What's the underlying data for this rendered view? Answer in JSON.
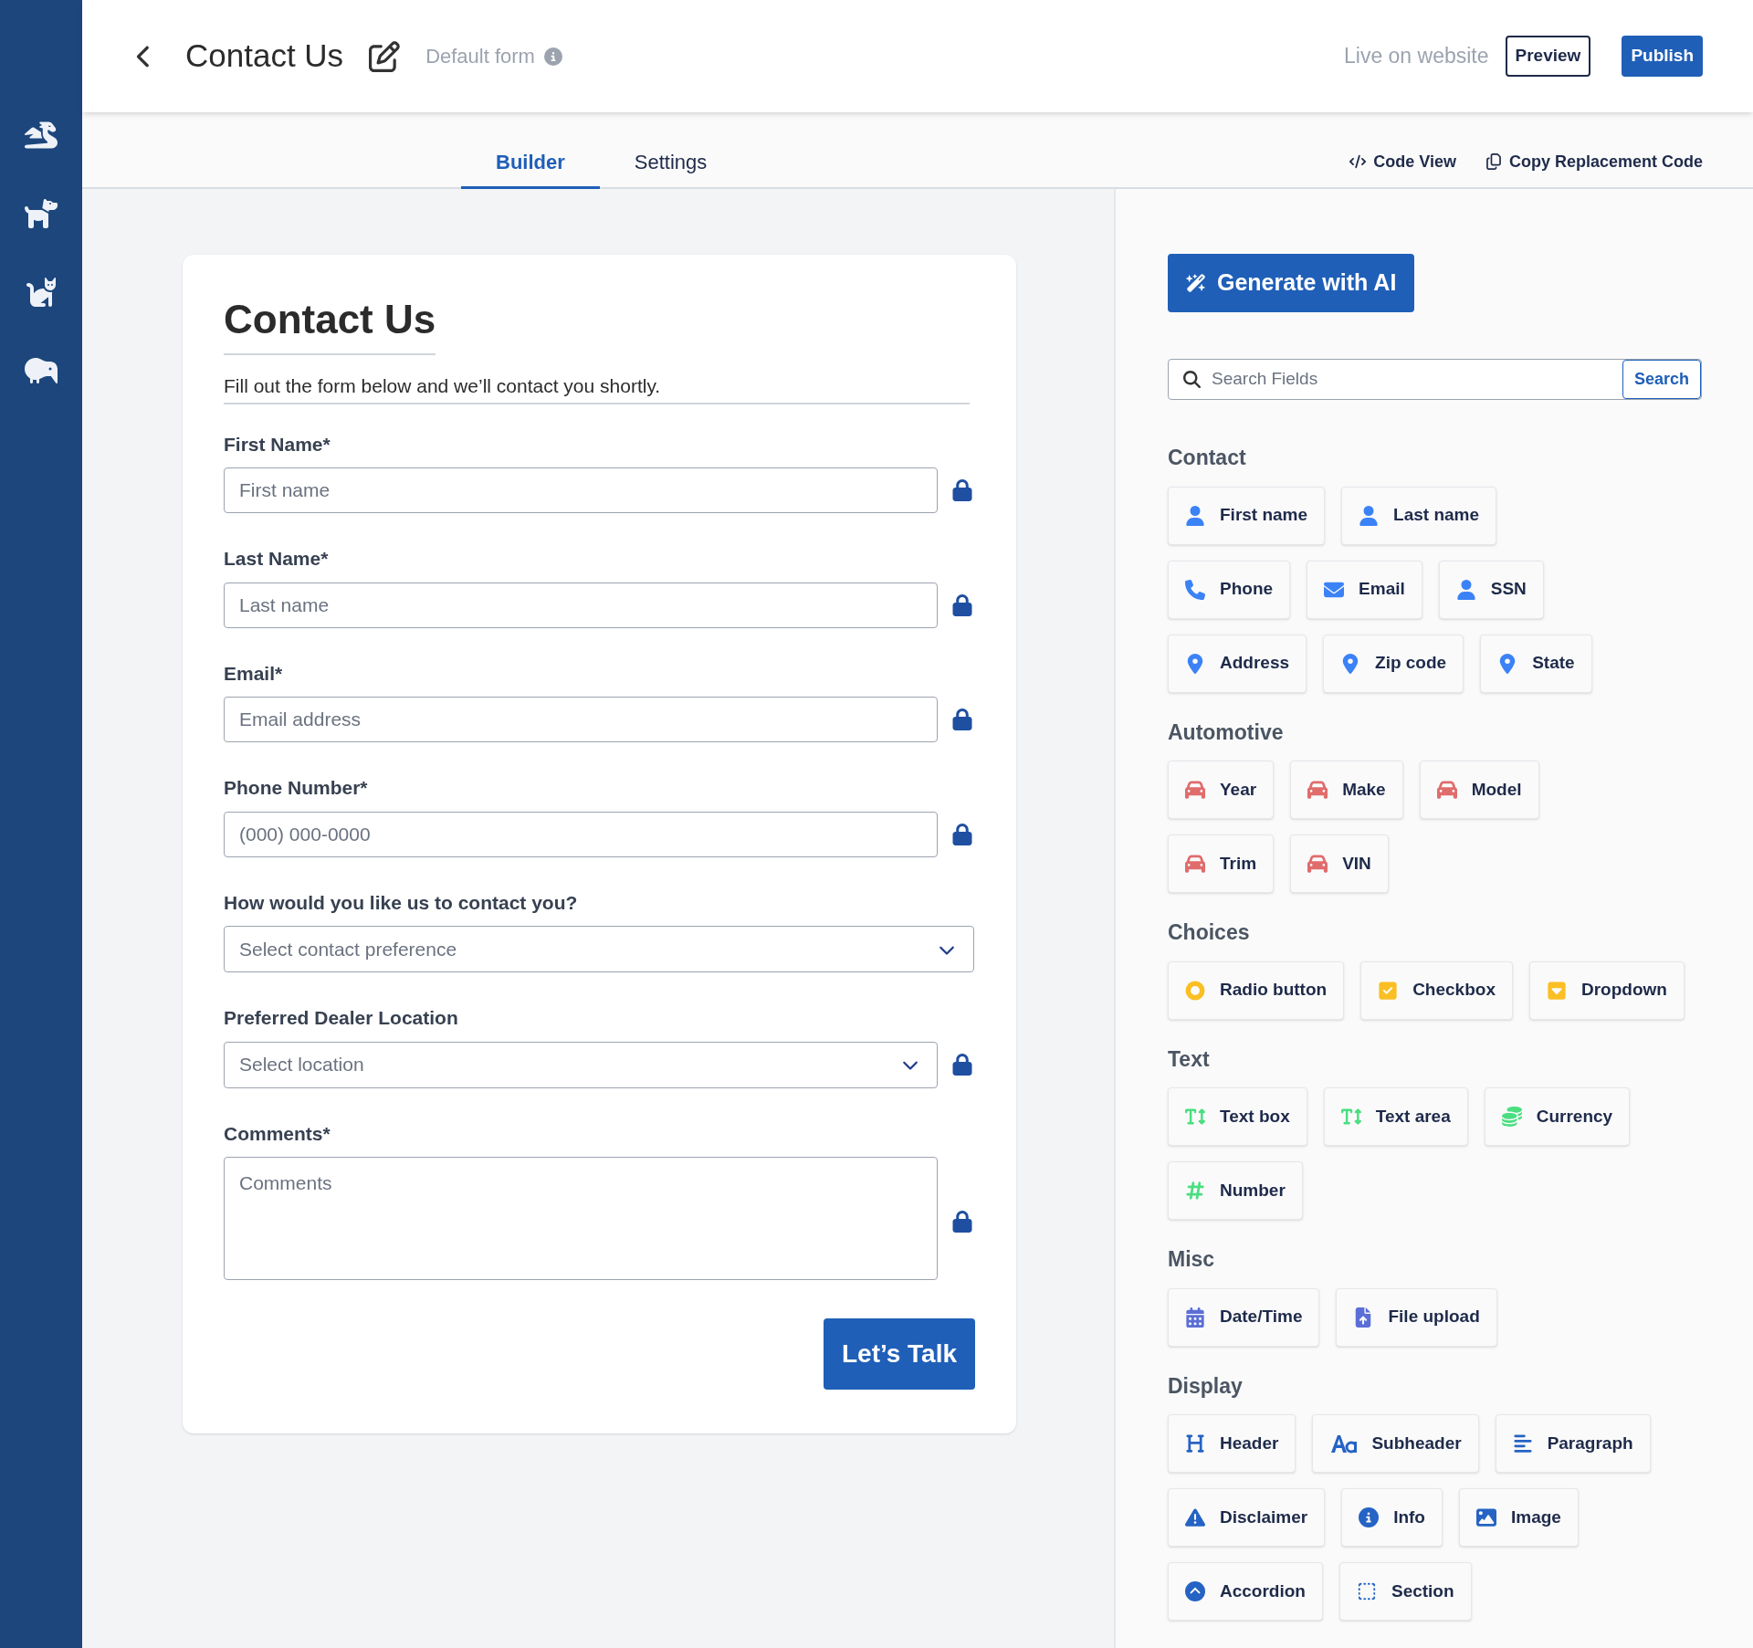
{
  "sidebar": {
    "items": [
      {
        "kind": "dragon"
      },
      {
        "kind": "dog"
      },
      {
        "kind": "cat"
      },
      {
        "kind": "kiwi"
      }
    ]
  },
  "header": {
    "title": "Contact Us",
    "subtitle": "Default form",
    "status": "Live on website",
    "buttons": [
      {
        "label": "Preview",
        "kind": "outline"
      },
      {
        "label": "Publish",
        "kind": "solid"
      }
    ]
  },
  "tabs": [
    {
      "label": "Builder",
      "selected": true
    },
    {
      "label": "Settings",
      "selected": false
    }
  ],
  "toolbar": [
    {
      "label": "Code View",
      "kind": "code"
    },
    {
      "label": "Copy Replacement Code",
      "kind": "copy"
    }
  ],
  "form": {
    "title": "Contact Us",
    "description": "Fill out the form below and we’ll contact you shortly.",
    "fields": [
      {
        "label": "First Name*",
        "kind": "input",
        "placeholder": "First name",
        "locked": true
      },
      {
        "label": "Last Name*",
        "kind": "input",
        "placeholder": "Last name",
        "locked": true
      },
      {
        "label": "Email*",
        "kind": "input",
        "placeholder": "Email address",
        "locked": true
      },
      {
        "label": "Phone Number*",
        "kind": "input",
        "placeholder": "(000) 000-0000",
        "locked": true
      },
      {
        "label": "How would you like us to contact you?",
        "kind": "select",
        "placeholder": "Select contact preference",
        "locked": false
      },
      {
        "label": "Preferred Dealer Location",
        "kind": "select",
        "placeholder": "Select location",
        "locked": true
      },
      {
        "label": "Comments*",
        "kind": "textarea",
        "placeholder": "Comments",
        "locked": true
      }
    ],
    "submit": "Let’s Talk"
  },
  "panel": {
    "ai_button": "Generate with AI",
    "search": {
      "placeholder": "Search Fields",
      "button": "Search"
    },
    "groups": [
      {
        "title": "Contact",
        "rows": [
          [
            {
              "label": "First name",
              "kind": "person"
            },
            {
              "label": "Last name",
              "kind": "person"
            }
          ],
          [
            {
              "label": "Phone",
              "kind": "phone"
            },
            {
              "label": "Email",
              "kind": "mail"
            },
            {
              "label": "SSN",
              "kind": "person"
            }
          ],
          [
            {
              "label": "Address",
              "kind": "pin"
            },
            {
              "label": "Zip code",
              "kind": "pin"
            },
            {
              "label": "State",
              "kind": "pin"
            }
          ]
        ]
      },
      {
        "title": "Automotive",
        "rows": [
          [
            {
              "label": "Year",
              "kind": "car"
            },
            {
              "label": "Make",
              "kind": "car"
            },
            {
              "label": "Model",
              "kind": "car"
            }
          ],
          [
            {
              "label": "Trim",
              "kind": "car"
            },
            {
              "label": "VIN",
              "kind": "car"
            }
          ]
        ]
      },
      {
        "title": "Choices",
        "rows": [
          [
            {
              "label": "Radio button",
              "kind": "radio"
            },
            {
              "label": "Checkbox",
              "kind": "checkbox"
            },
            {
              "label": "Dropdown",
              "kind": "dropdown"
            }
          ]
        ]
      },
      {
        "title": "Text",
        "rows": [
          [
            {
              "label": "Text box",
              "kind": "text"
            },
            {
              "label": "Text area",
              "kind": "text"
            },
            {
              "label": "Currency",
              "kind": "coins"
            }
          ],
          [
            {
              "label": "Number",
              "kind": "hash"
            }
          ]
        ]
      },
      {
        "title": "Misc",
        "rows": [
          [
            {
              "label": "Date/Time",
              "kind": "calendar"
            },
            {
              "label": "File upload",
              "kind": "upload"
            }
          ]
        ]
      },
      {
        "title": "Display",
        "rows": [
          [
            {
              "label": "Header",
              "kind": "heading"
            },
            {
              "label": "Subheader",
              "kind": "font"
            },
            {
              "label": "Paragraph",
              "kind": "lines"
            }
          ],
          [
            {
              "label": "Disclaimer",
              "kind": "warning"
            },
            {
              "label": "Info",
              "kind": "info"
            },
            {
              "label": "Image",
              "kind": "image"
            }
          ],
          [
            {
              "label": "Accordion",
              "kind": "accordion"
            },
            {
              "label": "Section",
              "kind": "section"
            }
          ]
        ]
      }
    ]
  }
}
